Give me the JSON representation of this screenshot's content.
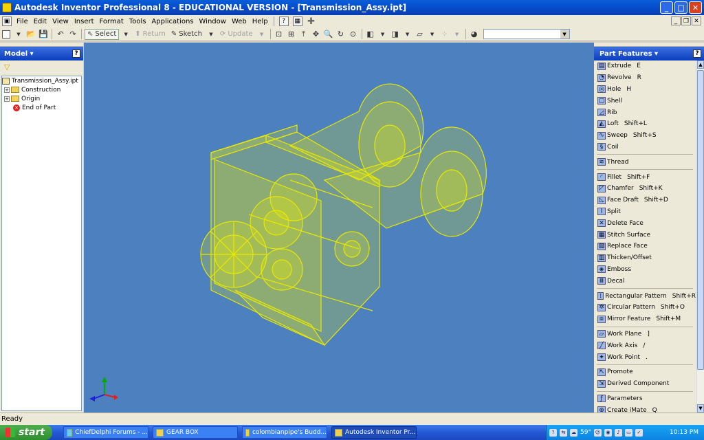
{
  "window": {
    "title": "Autodesk Inventor Professional 8  - EDUCATIONAL VERSION - [Transmission_Assy.ipt]",
    "buttons": {
      "minimize": "_",
      "maximize": "□",
      "close": "✕"
    }
  },
  "menubar": {
    "items": [
      {
        "label": "File"
      },
      {
        "label": "Edit"
      },
      {
        "label": "View"
      },
      {
        "label": "Insert"
      },
      {
        "label": "Format"
      },
      {
        "label": "Tools"
      },
      {
        "label": "Applications"
      },
      {
        "label": "Window"
      },
      {
        "label": "Web"
      },
      {
        "label": "Help"
      }
    ]
  },
  "toolbar": {
    "select_label": "Select",
    "return_label": "Return",
    "sketch_label": "Sketch",
    "update_label": "Update",
    "combo_value": ""
  },
  "model_panel": {
    "title": "Model ▾",
    "help": "?",
    "tree": [
      {
        "label": "Transmission_Assy.ipt",
        "kind": "root"
      },
      {
        "label": "Construction",
        "kind": "folder"
      },
      {
        "label": "Origin",
        "kind": "folder"
      },
      {
        "label": "End of Part",
        "kind": "end"
      }
    ]
  },
  "features_panel": {
    "title": "Part Features ▾",
    "help": "?",
    "items": [
      {
        "label": "Extrude",
        "key": "E",
        "icon": "extrude-icon"
      },
      {
        "label": "Revolve",
        "key": "R",
        "icon": "revolve-icon"
      },
      {
        "label": "Hole",
        "key": "H",
        "icon": "hole-icon"
      },
      {
        "label": "Shell",
        "key": "",
        "icon": "shell-icon"
      },
      {
        "label": "Rib",
        "key": "",
        "icon": "rib-icon"
      },
      {
        "label": "Loft",
        "key": "Shift+L",
        "icon": "loft-icon"
      },
      {
        "label": "Sweep",
        "key": "Shift+S",
        "icon": "sweep-icon"
      },
      {
        "label": "Coil",
        "key": "",
        "icon": "coil-icon"
      },
      {
        "label": "Thread",
        "key": "",
        "icon": "thread-icon"
      },
      {
        "label": "Fillet",
        "key": "Shift+F",
        "icon": "fillet-icon"
      },
      {
        "label": "Chamfer",
        "key": "Shift+K",
        "icon": "chamfer-icon"
      },
      {
        "label": "Face Draft",
        "key": "Shift+D",
        "icon": "face-draft-icon"
      },
      {
        "label": "Split",
        "key": "",
        "icon": "split-icon"
      },
      {
        "label": "Delete Face",
        "key": "",
        "icon": "delete-face-icon"
      },
      {
        "label": "Stitch Surface",
        "key": "",
        "icon": "stitch-surface-icon"
      },
      {
        "label": "Replace Face",
        "key": "",
        "icon": "replace-face-icon"
      },
      {
        "label": "Thicken/Offset",
        "key": "",
        "icon": "thicken-icon"
      },
      {
        "label": "Emboss",
        "key": "",
        "icon": "emboss-icon"
      },
      {
        "label": "Decal",
        "key": "",
        "icon": "decal-icon"
      },
      {
        "label": "Rectangular Pattern",
        "key": "Shift+R",
        "icon": "rect-pattern-icon"
      },
      {
        "label": "Circular Pattern",
        "key": "Shift+O",
        "icon": "circ-pattern-icon"
      },
      {
        "label": "Mirror Feature",
        "key": "Shift+M",
        "icon": "mirror-icon"
      },
      {
        "label": "Work Plane",
        "key": "]",
        "icon": "work-plane-icon"
      },
      {
        "label": "Work Axis",
        "key": "/",
        "icon": "work-axis-icon"
      },
      {
        "label": "Work Point",
        "key": ".",
        "icon": "work-point-icon"
      },
      {
        "label": "Promote",
        "key": "",
        "icon": "promote-icon"
      },
      {
        "label": "Derived Component",
        "key": "",
        "icon": "derived-icon"
      },
      {
        "label": "Parameters",
        "key": "",
        "icon": "parameters-icon"
      },
      {
        "label": "Create iMate",
        "key": "Q",
        "icon": "imate-icon"
      }
    ]
  },
  "status": {
    "text": "Ready"
  },
  "taskbar": {
    "start_label": "start",
    "items": [
      {
        "label": "ChiefDelphi Forums - ..."
      },
      {
        "label": "GEAR BOX"
      },
      {
        "label": "colombianpipe's Budd..."
      },
      {
        "label": "Autodesk Inventor Pr..."
      }
    ],
    "temperature": "59°",
    "clock": "10:13 PM"
  },
  "colors": {
    "viewport_bg": "#4c80bf",
    "model_wireframe": "#e8e800",
    "panel_header": "#1c4cc8"
  }
}
